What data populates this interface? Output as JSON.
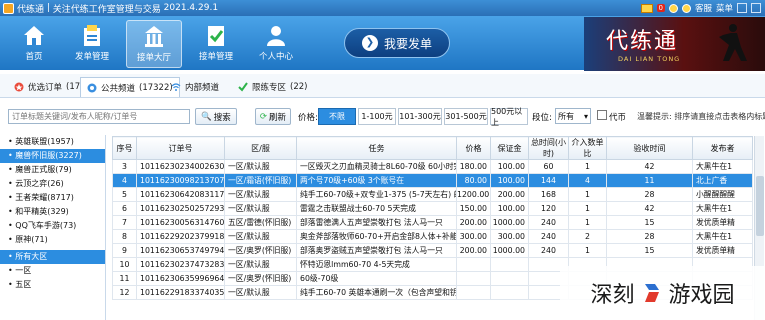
{
  "titlebar": {
    "app_name": "代练通",
    "slogan": "关注代练工作室管理与交易",
    "version": "2021.4.29.1",
    "mail_badge": "0",
    "service_label": "客服",
    "menu_label": "菜单"
  },
  "nav": {
    "items": [
      {
        "label": "首页",
        "icon": "home-icon"
      },
      {
        "label": "发单管理",
        "icon": "send-order-icon"
      },
      {
        "label": "接单大厅",
        "icon": "order-hall-icon"
      },
      {
        "label": "接单管理",
        "icon": "accept-manage-icon"
      },
      {
        "label": "个人中心",
        "icon": "user-icon"
      }
    ],
    "active_index": 2,
    "big_button": "我要发单"
  },
  "logo": {
    "title": "代练通",
    "subtitle": "DAI LIAN TONG"
  },
  "tabs": [
    {
      "label": "优选订单",
      "count": "(17)"
    },
    {
      "label": "公共频道",
      "count": "(17322)"
    },
    {
      "label": "内部频道",
      "count": ""
    },
    {
      "label": "限练专区",
      "count": "(22)"
    }
  ],
  "filter": {
    "search_placeholder": "订单标题关键词/发布人昵称/订单号",
    "search_button": "搜索",
    "refresh_button": "刷新",
    "price_label": "价格:",
    "price_options": [
      "不限",
      "1-100元",
      "101-300元",
      "301-500元",
      "500元以上"
    ],
    "price_selected": 0,
    "duan_label": "段位:",
    "duan_value": "所有",
    "checkbox_label": "代币",
    "hint": "温馨提示: 排序请直接点击表格内标题"
  },
  "sidebar": {
    "games": [
      "英雄联盟(1957)",
      "魔兽怀旧服(3227)",
      "魔兽正式服(79)",
      "云顶之弈(26)",
      "王者荣耀(8717)",
      "和平精英(329)",
      "QQ飞车手游(73)",
      "原神(71)"
    ],
    "selected_game": 1,
    "regions": [
      "所有大区",
      "一区",
      "五区"
    ],
    "selected_region": 0
  },
  "table": {
    "headers": [
      "序号",
      "订单号",
      "区/服",
      "任务",
      "价格",
      "保证金",
      "总时间(小时)",
      "介入数单比",
      "验收时间",
      "发布者"
    ],
    "rows": [
      [
        "3",
        "10116230234002630338",
        "一区/默认服",
        "一区毁灭之刃血精灵骑士8L60-70级 60小时完成",
        "180.00",
        "100.00",
        "60",
        "1",
        "42",
        "大黑牛在1"
      ],
      [
        "4",
        "10116230098213707320",
        "一区/霜语(怀旧服)",
        "两个号70级+60级 3个账号在",
        "80.00",
        "100.00",
        "144",
        "4",
        "11",
        "北上广香"
      ],
      [
        "5",
        "10116230642083117795",
        "一区/默认服",
        "纯手工60-70级+双专业1-375 (5-7天左右) 邮箱，珠宝",
        "1200.00",
        "200.00",
        "168",
        "1",
        "28",
        "小醒醒醒醒"
      ],
      [
        "6",
        "10116230250257293953",
        "一区/默认服",
        "雷霆之击联盟战士60-70 5天完成",
        "150.00",
        "100.00",
        "120",
        "1",
        "42",
        "大黑牛在1"
      ],
      [
        "7",
        "10116230056314760800",
        "五区/雷德(怀旧服)",
        "部落雷德满人五声望崇敬打包 法人马一只",
        "200.00",
        "1000.00",
        "240",
        "1",
        "15",
        "发优质单精"
      ],
      [
        "8",
        "10116229202379918164",
        "一区/默认服",
        "奥金斧部落牧师60-70+开启金部8人体+补能醉开门【开",
        "300.00",
        "300.00",
        "240",
        "2",
        "28",
        "大黑牛在1"
      ],
      [
        "9",
        "10116230653749794345",
        "一区/奥罗(怀旧服)",
        "部落奥罗盗贼五声望崇敬打包 法人马一只",
        "200.00",
        "1000.00",
        "240",
        "1",
        "15",
        "发优质单精"
      ],
      [
        "10",
        "10116230237473283761",
        "一区/默认服",
        "怀特迈恩lmm60-70  4-5天完成",
        "",
        "",
        "",
        "",
        "",
        ""
      ],
      [
        "11",
        "10116230635996964045",
        "一区/奥罗(怀旧服)",
        "60级-70级",
        "",
        "",
        "",
        "",
        "",
        ""
      ],
      [
        "12",
        "10116229183374035168",
        "一区/默认服",
        "纯手工60-70  英雄本通刷一次（包含声望和钥匙任务）",
        "",
        "",
        "",
        "",
        "",
        ""
      ]
    ],
    "selected_row": 1
  },
  "watermark": {
    "text": "深刻",
    "text2": "游戏园"
  }
}
